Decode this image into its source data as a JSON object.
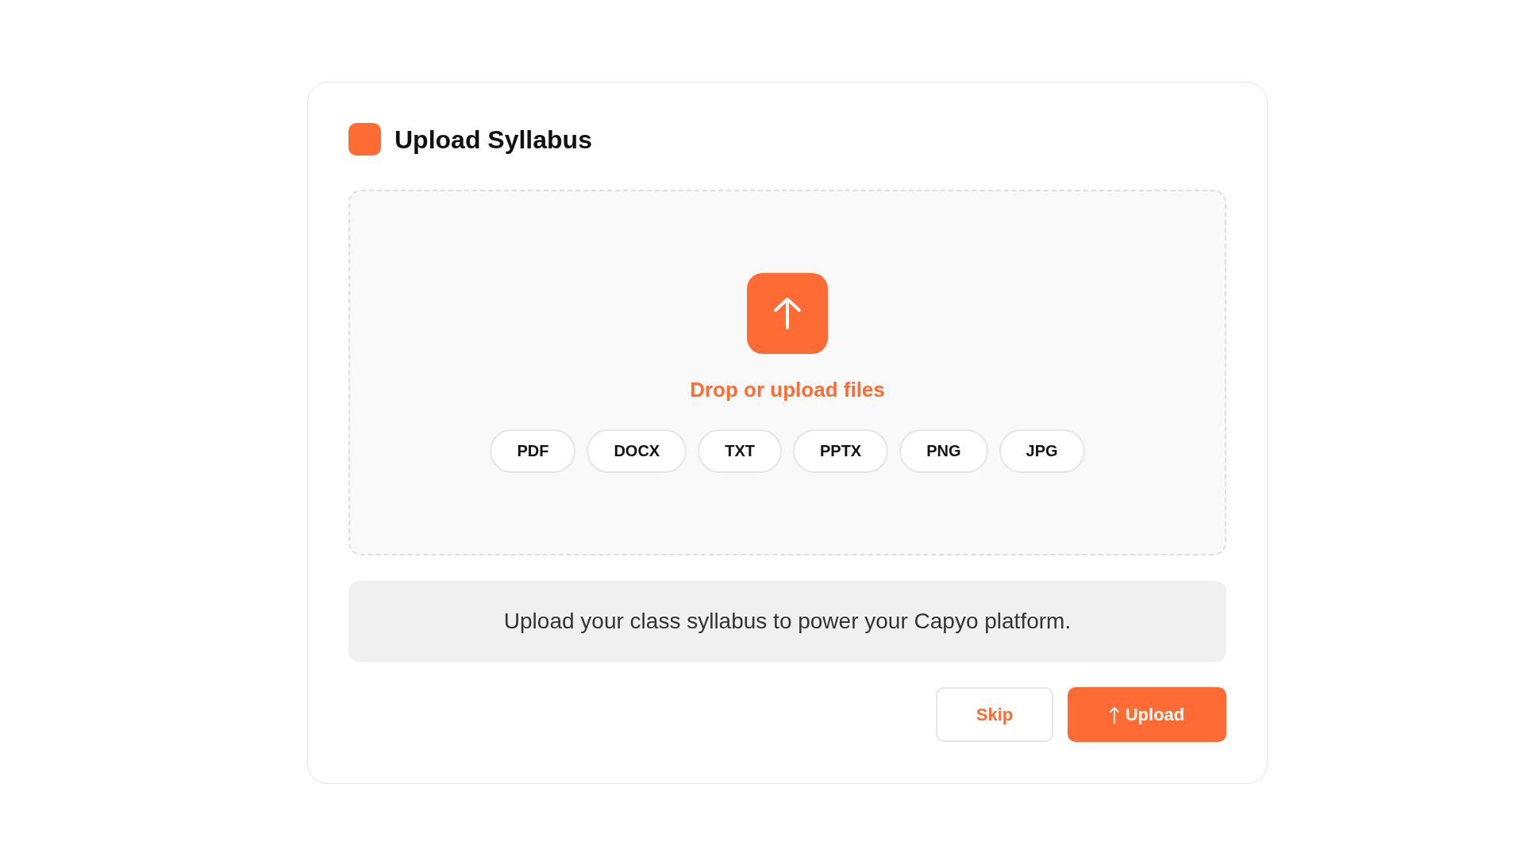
{
  "header": {
    "title": "Upload Syllabus"
  },
  "dropzone": {
    "prompt": "Drop or upload files",
    "file_types": [
      "PDF",
      "DOCX",
      "TXT",
      "PPTX",
      "PNG",
      "JPG"
    ]
  },
  "info": {
    "text": "Upload your class syllabus to power your Capyo platform."
  },
  "actions": [
    {
      "label": "Skip",
      "kind": "secondary"
    },
    {
      "label": "Upload",
      "kind": "primary"
    }
  ]
}
